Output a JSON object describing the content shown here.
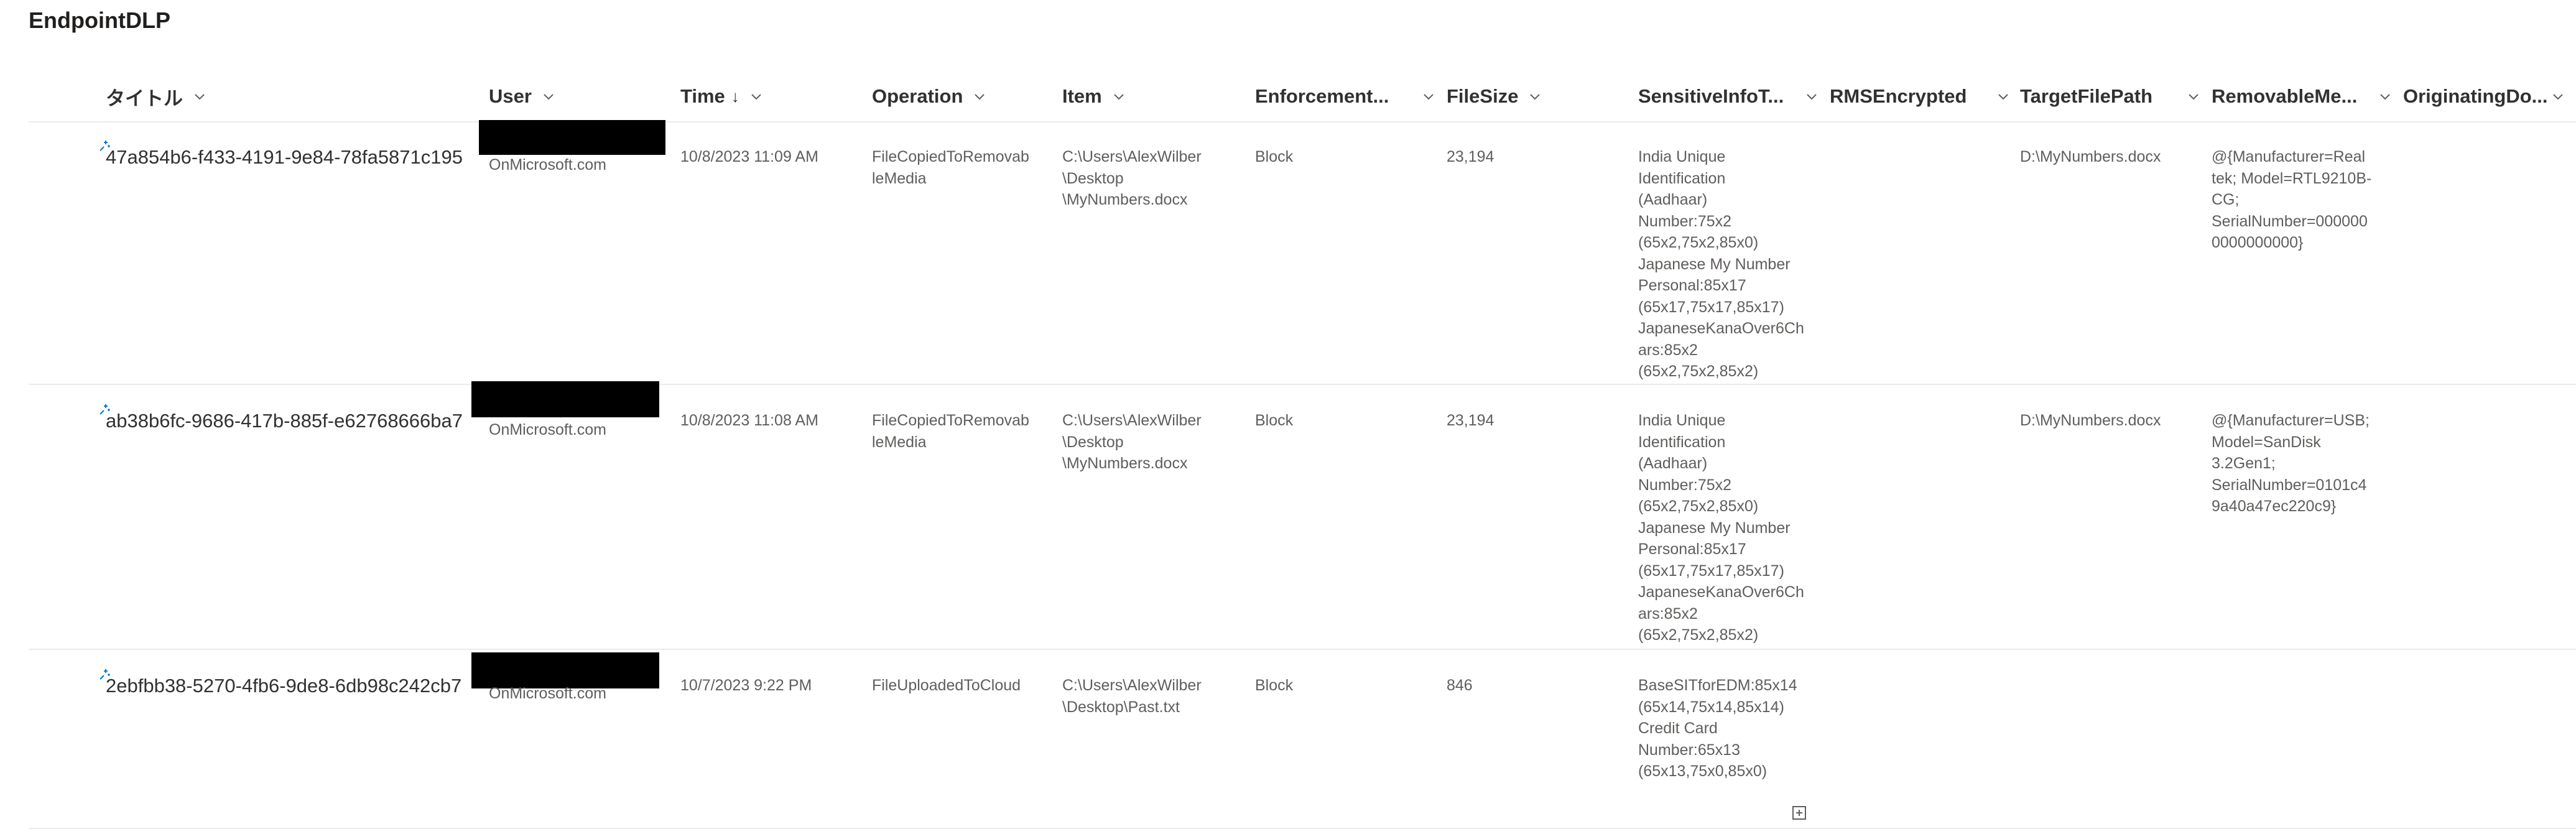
{
  "list_title": "EndpointDLP",
  "columns": [
    {
      "key": "title",
      "label": "タイトル"
    },
    {
      "key": "user",
      "label": "User"
    },
    {
      "key": "time",
      "label": "Time",
      "sort_indicator": "↓"
    },
    {
      "key": "operation",
      "label": "Operation"
    },
    {
      "key": "item",
      "label": "Item"
    },
    {
      "key": "enforcement",
      "label": "Enforcement..."
    },
    {
      "key": "filesize",
      "label": "FileSize"
    },
    {
      "key": "sensitive",
      "label": "SensitiveInfoT..."
    },
    {
      "key": "rms",
      "label": "RMSEncrypted"
    },
    {
      "key": "target",
      "label": "TargetFilePath"
    },
    {
      "key": "removable",
      "label": "RemovableMe..."
    },
    {
      "key": "originating",
      "label": "OriginatingDo..."
    }
  ],
  "rows": [
    {
      "title": "47a854b6-f433-4191-9e84-78fa5871c195",
      "user": "OnMicrosoft.com",
      "time": "10/8/2023 11:09 AM",
      "operation": "FileCopiedToRemovab\nleMedia",
      "item": "C:\\Users\\AlexWilber\n\\Desktop\n\\MyNumbers.docx",
      "enforcement": "Block",
      "filesize": "23,194",
      "sensitive": "India Unique\nIdentification\n(Aadhaar)\nNumber:75x2\n(65x2,75x2,85x0)\nJapanese My Number\nPersonal:85x17\n(65x17,75x17,85x17)\nJapaneseKanaOver6Ch\nars:85x2\n(65x2,75x2,85x2)",
      "rms": "",
      "target": "D:\\MyNumbers.docx",
      "removable": "@{Manufacturer=Real\ntek; Model=RTL9210B-\nCG;\nSerialNumber=000000\n0000000000}",
      "originating": ""
    },
    {
      "title": "ab38b6fc-9686-417b-885f-e62768666ba7",
      "user": "OnMicrosoft.com",
      "time": "10/8/2023 11:08 AM",
      "operation": "FileCopiedToRemovab\nleMedia",
      "item": "C:\\Users\\AlexWilber\n\\Desktop\n\\MyNumbers.docx",
      "enforcement": "Block",
      "filesize": "23,194",
      "sensitive": "India Unique\nIdentification\n(Aadhaar)\nNumber:75x2\n(65x2,75x2,85x0)\nJapanese My Number\nPersonal:85x17\n(65x17,75x17,85x17)\nJapaneseKanaOver6Ch\nars:85x2\n(65x2,75x2,85x2)",
      "rms": "",
      "target": "D:\\MyNumbers.docx",
      "removable": "@{Manufacturer=USB;\nModel=SanDisk\n3.2Gen1;\nSerialNumber=0101c4\n9a40a47ec220c9}",
      "originating": ""
    },
    {
      "title": "2ebfbb38-5270-4fb6-9de8-6db98c242cb7",
      "user": "OnMicrosoft.com",
      "time": "10/7/2023 9:22 PM",
      "operation": "FileUploadedToCloud",
      "item": "C:\\Users\\AlexWilber\n\\Desktop\\Past.txt",
      "enforcement": "Block",
      "filesize": "846",
      "sensitive": "BaseSITforEDM:85x14\n(65x14,75x14,85x14)\nCredit Card\nNumber:65x13\n(65x13,75x0,85x0)",
      "rms": "",
      "target": "",
      "removable": "",
      "originating": ""
    }
  ],
  "icons": {
    "new_item": "new-item-sparkle-icon",
    "column_menu": "chevron-down-icon",
    "bottom": "add-column-icon"
  },
  "colors": {
    "accent": "#0078d4",
    "text_primary": "#323130",
    "text_secondary": "#605e5c",
    "divider": "#edebe9"
  }
}
